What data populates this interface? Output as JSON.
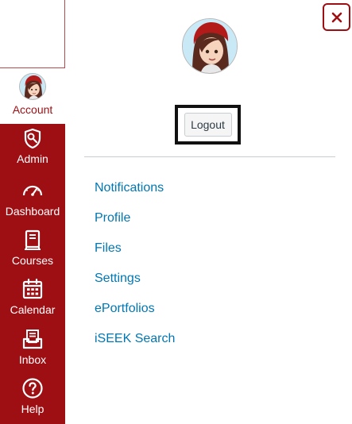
{
  "global_nav": {
    "items": [
      {
        "label": "Account",
        "icon": "avatar-icon"
      },
      {
        "label": "Admin",
        "icon": "shield-icon"
      },
      {
        "label": "Dashboard",
        "icon": "dashboard-icon"
      },
      {
        "label": "Courses",
        "icon": "courses-icon"
      },
      {
        "label": "Calendar",
        "icon": "calendar-icon"
      },
      {
        "label": "Inbox",
        "icon": "inbox-icon"
      },
      {
        "label": "Help",
        "icon": "help-icon"
      }
    ],
    "colors": {
      "background": "#9e0f14",
      "active_background": "#ffffff",
      "active_text": "#9e0f14"
    }
  },
  "tray": {
    "close_icon": "close-icon",
    "logout_label": "Logout",
    "links": [
      "Notifications",
      "Profile",
      "Files",
      "Settings",
      "ePortfolios",
      "iSEEK Search"
    ],
    "colors": {
      "link": "#0077b3",
      "accent": "#9e0f14"
    }
  }
}
